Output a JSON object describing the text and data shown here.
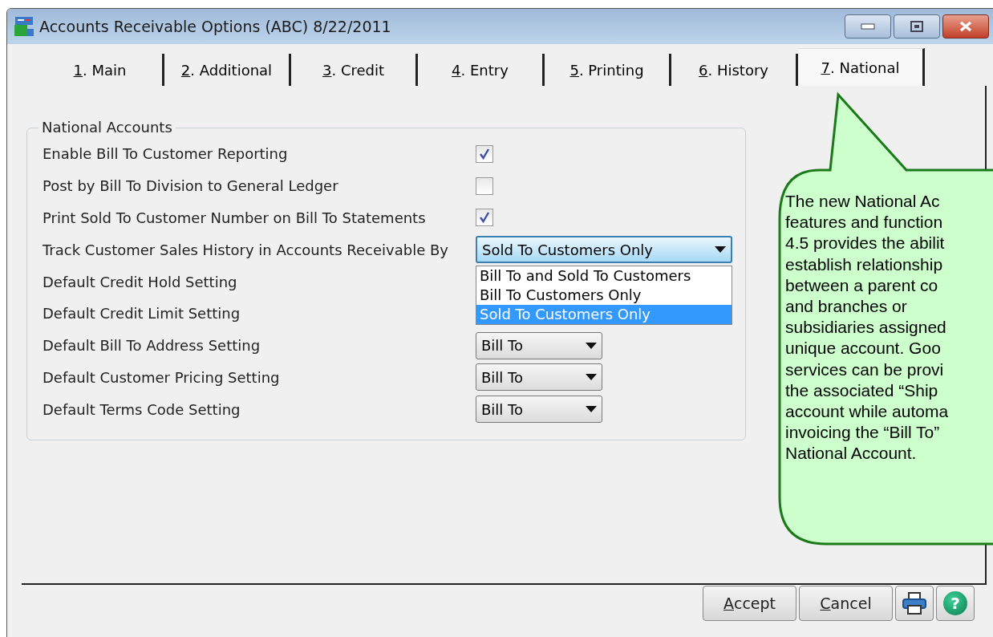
{
  "window": {
    "title": "Accounts Receivable Options (ABC) 8/22/2011"
  },
  "tabs": [
    {
      "label": "1. Main",
      "selected": false
    },
    {
      "label": "2. Additional",
      "selected": false
    },
    {
      "label": "3. Credit",
      "selected": false
    },
    {
      "label": "4. Entry",
      "selected": false
    },
    {
      "label": "5. Printing",
      "selected": false
    },
    {
      "label": "6. History",
      "selected": false
    },
    {
      "label": "7. National",
      "selected": true
    }
  ],
  "group": {
    "title": "National Accounts",
    "rows": [
      {
        "label": "Enable Bill To Customer Reporting",
        "kind": "checkbox",
        "checked": true
      },
      {
        "label": "Post by Bill To Division to General Ledger",
        "kind": "checkbox",
        "checked": false
      },
      {
        "label": "Print Sold To Customer Number on Bill To Statements",
        "kind": "checkbox",
        "checked": true
      },
      {
        "label": "Track Customer Sales History in Accounts Receivable By",
        "kind": "combo",
        "value": "Sold To Customers Only",
        "expanded": true,
        "options": [
          {
            "label": "Bill To and Sold To Customers",
            "selected": false
          },
          {
            "label": "Bill To Customers Only",
            "selected": false
          },
          {
            "label": "Sold To Customers Only",
            "selected": true
          }
        ]
      },
      {
        "label": "Default Credit Hold Setting",
        "kind": "label"
      },
      {
        "label": "Default Credit Limit Setting",
        "kind": "label"
      },
      {
        "label": "Default Bill To Address Setting",
        "kind": "combo",
        "value": "Bill To",
        "expanded": false
      },
      {
        "label": "Default Customer Pricing Setting",
        "kind": "combo",
        "value": "Bill To",
        "expanded": false
      },
      {
        "label": "Default Terms Code Setting",
        "kind": "combo",
        "value": "Bill To",
        "expanded": false
      }
    ]
  },
  "callout": {
    "lines": [
      "The new National Ac",
      "features and function",
      "4.5 provides the abilit",
      "establish relationship",
      "between a parent co",
      "and branches or",
      "subsidiaries assigned",
      "unique account. Goo",
      "services can be provi",
      "the associated “Ship",
      "account while automa",
      "invoicing the “Bill To”",
      "National Account."
    ]
  },
  "buttons": [
    {
      "kind": "text",
      "label": "Accept"
    },
    {
      "kind": "text",
      "label": "Cancel"
    },
    {
      "kind": "print"
    },
    {
      "kind": "help",
      "label": "?"
    }
  ]
}
